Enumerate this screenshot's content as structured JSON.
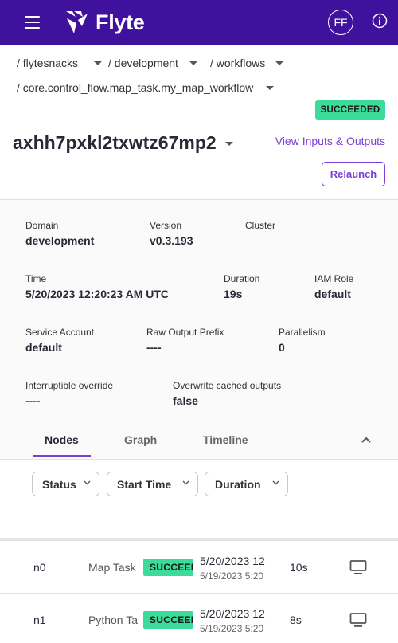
{
  "app": {
    "brand": "Flyte",
    "avatar_initials": "FF"
  },
  "breadcrumbs": [
    {
      "label": "/ flytesnacks"
    },
    {
      "label": "/ development"
    },
    {
      "label": "/ workflows"
    },
    {
      "label": "/ core.control_flow.map_task.my_map_workflow"
    }
  ],
  "execution": {
    "status": "SUCCEEDED",
    "id": "axhh7pxkl2txwtz67mp2",
    "view_io_label": "View Inputs & Outputs",
    "relaunch_label": "Relaunch"
  },
  "details": {
    "domain": {
      "label": "Domain",
      "value": "development"
    },
    "version": {
      "label": "Version",
      "value": "v0.3.193"
    },
    "cluster": {
      "label": "Cluster",
      "value": ""
    },
    "time": {
      "label": "Time",
      "value": "5/20/2023 12:20:23 AM UTC"
    },
    "duration": {
      "label": "Duration",
      "value": "19s"
    },
    "iam_role": {
      "label": "IAM Role",
      "value": "default"
    },
    "service_account": {
      "label": "Service Account",
      "value": "default"
    },
    "raw_output_prefix": {
      "label": "Raw Output Prefix",
      "value": "----"
    },
    "parallelism": {
      "label": "Parallelism",
      "value": "0"
    },
    "interruptible_override": {
      "label": "Interruptible override",
      "value": "----"
    },
    "overwrite_cached_outputs": {
      "label": "Overwrite cached outputs",
      "value": "false"
    }
  },
  "tabs": [
    {
      "label": "Nodes",
      "active": true
    },
    {
      "label": "Graph",
      "active": false
    },
    {
      "label": "Timeline",
      "active": false
    }
  ],
  "filters": [
    {
      "label": "Status"
    },
    {
      "label": "Start Time"
    },
    {
      "label": "Duration"
    }
  ],
  "nodes": [
    {
      "id": "n0",
      "type": "Map Task",
      "status": "SUCCEEDED",
      "start_time": "5/20/2023 12",
      "start_time_local": "5/19/2023 5:20",
      "duration": "10s"
    },
    {
      "id": "n1",
      "type": "Python Ta",
      "status": "SUCCEEDED",
      "start_time": "5/20/2023 12",
      "start_time_local": "5/19/2023 5:20",
      "duration": "8s"
    }
  ],
  "colors": {
    "header_bg": "#40119c",
    "accent": "#7b3fd8",
    "success": "#3ddb9a"
  }
}
